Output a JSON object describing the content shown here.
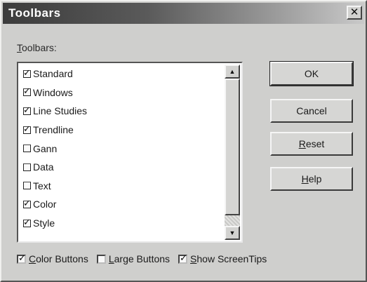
{
  "dialog": {
    "title": "Toolbars",
    "close_glyph": "✕"
  },
  "list_group": {
    "label_prefix": "T",
    "label_rest": "oolbars:"
  },
  "toolbars": [
    {
      "label": "Standard",
      "checked": true
    },
    {
      "label": "Windows",
      "checked": true
    },
    {
      "label": "Line Studies",
      "checked": true
    },
    {
      "label": "Trendline",
      "checked": true
    },
    {
      "label": "Gann",
      "checked": false
    },
    {
      "label": "Data",
      "checked": false
    },
    {
      "label": "Text",
      "checked": false
    },
    {
      "label": "Color",
      "checked": true
    },
    {
      "label": "Style",
      "checked": true
    }
  ],
  "scrollbar": {
    "up_glyph": "▲",
    "down_glyph": "▼"
  },
  "buttons": {
    "ok": "OK",
    "cancel": "Cancel",
    "reset_key": "R",
    "reset_rest": "eset",
    "help_key": "H",
    "help_rest": "elp"
  },
  "options": {
    "color_buttons": {
      "key": "C",
      "rest": "olor Buttons",
      "checked": true
    },
    "large_buttons": {
      "key": "L",
      "rest": "arge Buttons",
      "checked": false
    },
    "show_screentips": {
      "key": "S",
      "rest": "how ScreenTips",
      "checked": true
    }
  }
}
